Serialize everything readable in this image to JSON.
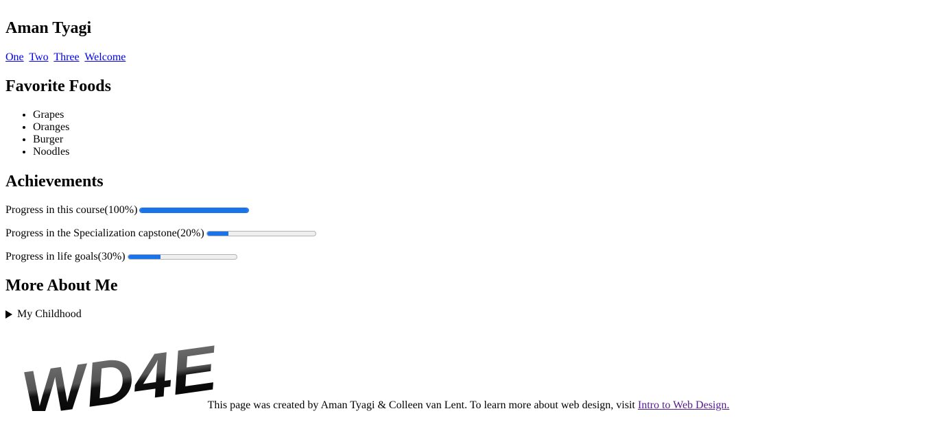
{
  "header": {
    "name": "Aman Tyagi"
  },
  "nav": {
    "links": [
      "One",
      "Two",
      "Three",
      "Welcome"
    ]
  },
  "foods": {
    "heading": "Favorite Foods",
    "items": [
      "Grapes",
      "Oranges",
      "Burger",
      "Noodles"
    ]
  },
  "achievements": {
    "heading": "Achievements",
    "items": [
      {
        "label": "Progress in this course(100%)",
        "progress": 1.0
      },
      {
        "label": "Progress in the Specialization capstone(20%)",
        "progress": 0.2
      },
      {
        "label": "Progress in life goals(30%)",
        "progress": 0.3
      }
    ]
  },
  "more": {
    "heading": "More About Me",
    "summary": "My Childhood"
  },
  "logo": {
    "text": "WD4E"
  },
  "footer": {
    "text": "This page was created by Aman Tyagi & Colleen van Lent. To learn more about web design, visit ",
    "link_text": "Intro to Web Design."
  },
  "colors": {
    "link": "#0000ee",
    "visited_link": "#551a8b",
    "progress_fill": "#1a73e8",
    "progress_track": "#efefef"
  }
}
